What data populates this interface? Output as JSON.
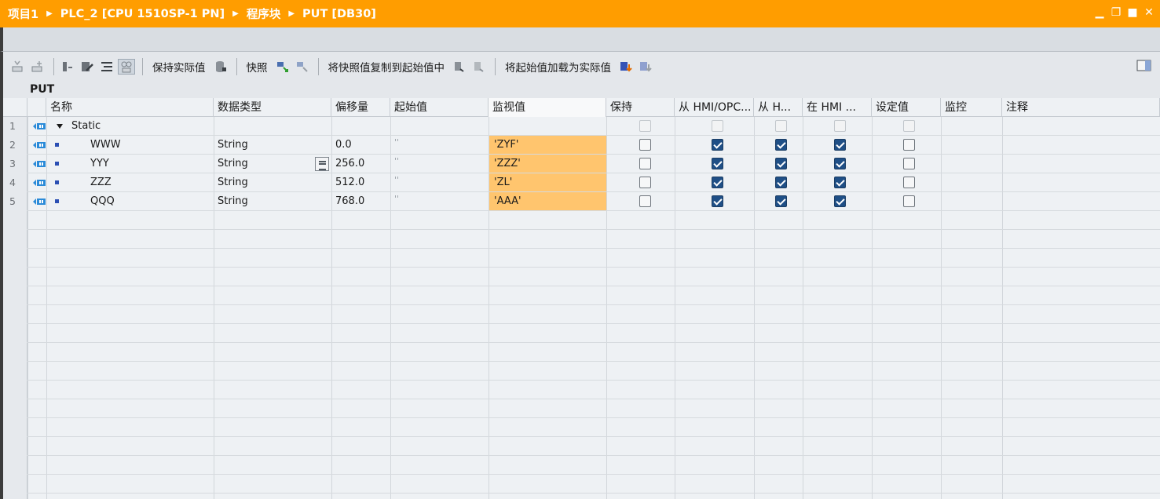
{
  "title": {
    "crumbs": [
      "项目1",
      "PLC_2 [CPU 1510SP-1 PN]",
      "程序块",
      "PUT [DB30]"
    ],
    "controls": [
      "minimize-icon",
      "restore-icon",
      "maximize-icon",
      "close-icon"
    ]
  },
  "toolbar": {
    "keep_actual_values": "保持实际值",
    "snapshot": "快照",
    "copy_snapshot_to_start": "将快照值复制到起始值中",
    "load_start_as_actual": "将起始值加载为实际值"
  },
  "block_name": "PUT",
  "columns": [
    "名称",
    "数据类型",
    "偏移量",
    "起始值",
    "监视值",
    "保持",
    "从 HMI/OPC...",
    "从 H...",
    "在 HMI ...",
    "设定值",
    "监控",
    "注释"
  ],
  "rows": [
    {
      "num": "1",
      "name": "Static",
      "type": "",
      "offset": "",
      "start": "",
      "monitor": "",
      "retain": "dis",
      "hmi1": "dis",
      "hmi2": "dis",
      "hmi3": "dis",
      "setpoint": "dis",
      "section": true
    },
    {
      "num": "2",
      "name": "WWW",
      "type": "String",
      "offset": "0.0",
      "start": "''",
      "monitor": "'ZYF'",
      "retain": "off",
      "hmi1": "on",
      "hmi2": "on",
      "hmi3": "on",
      "setpoint": "off"
    },
    {
      "num": "3",
      "name": "YYY",
      "type": "String",
      "offset": "256.0",
      "start": "''",
      "monitor": "'ZZZ'",
      "retain": "off",
      "hmi1": "on",
      "hmi2": "on",
      "hmi3": "on",
      "setpoint": "off"
    },
    {
      "num": "4",
      "name": "ZZZ",
      "type": "String",
      "offset": "512.0",
      "start": "''",
      "monitor": "'ZL'",
      "retain": "off",
      "hmi1": "on",
      "hmi2": "on",
      "hmi3": "on",
      "setpoint": "off"
    },
    {
      "num": "5",
      "name": "QQQ",
      "type": "String",
      "offset": "768.0",
      "start": "''",
      "monitor": "'AAA'",
      "retain": "off",
      "hmi1": "on",
      "hmi2": "on",
      "hmi3": "on",
      "setpoint": "off"
    }
  ],
  "colors": {
    "title_bar": "#ff9d00",
    "monitor_highlight": "#ffc56e",
    "checked": "#1f4f86"
  }
}
